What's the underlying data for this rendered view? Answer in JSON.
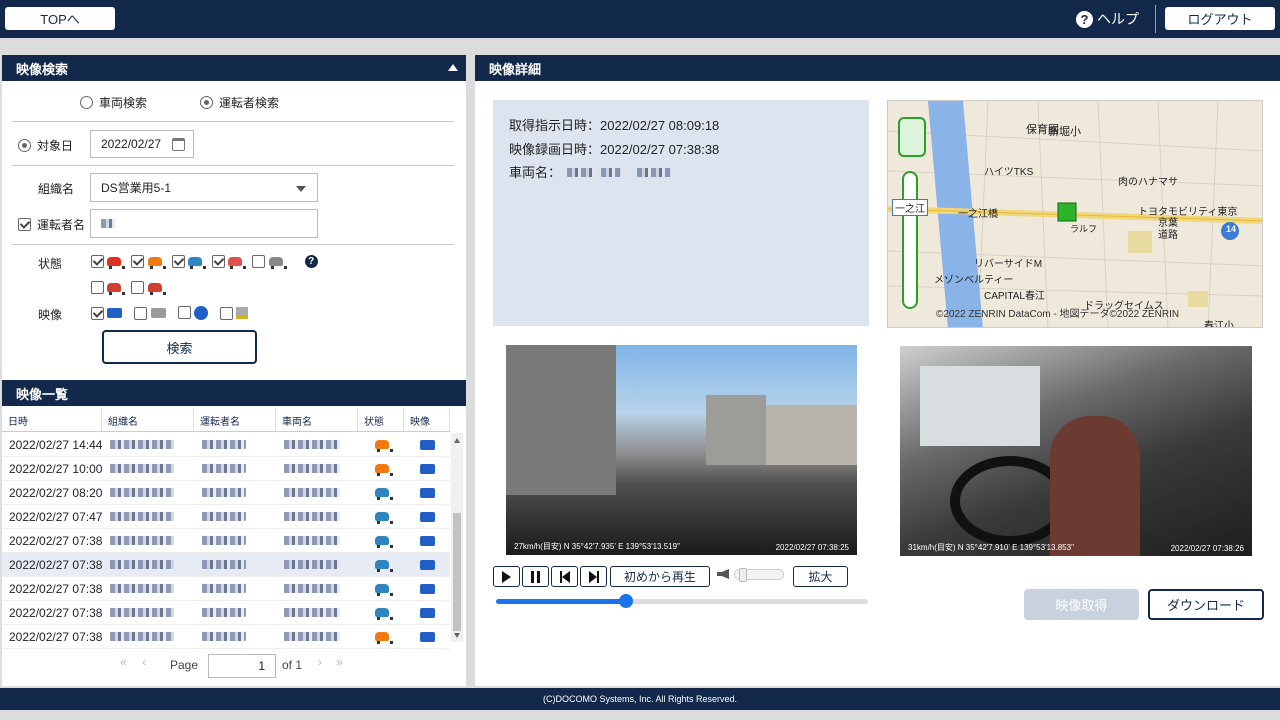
{
  "header": {
    "top_button": "TOPへ",
    "help": "ヘルプ",
    "logout": "ログアウト"
  },
  "search": {
    "title": "映像検索",
    "radio_vehicle": "車両検索",
    "radio_driver": "運転者検索",
    "date_label": "対象日",
    "date_value": "2022/02/27",
    "org_label": "組織名",
    "org_value": "DS営業用5-1",
    "driver_label": "運転者名",
    "status_label": "状態",
    "video_label": "映像",
    "search_button": "検索"
  },
  "list": {
    "title": "映像一覧",
    "columns": [
      "日時",
      "組織名",
      "運転者名",
      "車両名",
      "状態",
      "映像"
    ],
    "rows": [
      {
        "datetime": "2022/02/27 14:44",
        "status": "orange"
      },
      {
        "datetime": "2022/02/27 10:00",
        "status": "orange"
      },
      {
        "datetime": "2022/02/27 08:20",
        "status": "blue"
      },
      {
        "datetime": "2022/02/27 07:47",
        "status": "blue"
      },
      {
        "datetime": "2022/02/27 07:38",
        "status": "blue"
      },
      {
        "datetime": "2022/02/27 07:38",
        "status": "blue"
      },
      {
        "datetime": "2022/02/27 07:38",
        "status": "blue"
      },
      {
        "datetime": "2022/02/27 07:38",
        "status": "blue"
      },
      {
        "datetime": "2022/02/27 07:38",
        "status": "orange"
      }
    ],
    "pager": {
      "page_label": "Page",
      "page_value": "1",
      "of_label": "of 1"
    }
  },
  "detail": {
    "title": "映像詳細",
    "acquire_line": "取得指示日時：2022/02/27 08:09:18",
    "record_line": "映像録画日時：2022/02/27 07:38:38",
    "vehicle_label": "車両名：",
    "map": {
      "labels": [
        "保育園",
        "新堀小",
        "ハイツTKS",
        "肉のハナマサ",
        "一之江",
        "一之江橋",
        "トヨタモビリティ東京",
        "京葉道路",
        "ラルフ",
        "リバーサイドM",
        "メゾンベルティー",
        "CAPITAL春江",
        "ドラッグセイムス",
        "春江小"
      ],
      "copyright": "©2022 ZENRIN DataCom - 地図データ©2022 ZENRIN",
      "route_number": "14"
    },
    "front_video": {
      "overlay_speed": "27km/h(目安)  N 35°42'7.935'  E 139°53'13.519\"",
      "overlay_time": "2022/02/27 07:38:25"
    },
    "cabin_video": {
      "overlay_speed": "31km/h(目安)  N 35°42'7.910'  E 139°53'13.853\"",
      "overlay_time": "2022/02/27 07:38:26"
    },
    "controls": {
      "restart": "初めから再生",
      "zoom": "拡大",
      "progress": 0.35
    },
    "acquire_button": "映像取得",
    "download_button": "ダウンロード"
  },
  "footer": "(C)DOCOMO Systems, Inc. All Rights Reserved."
}
